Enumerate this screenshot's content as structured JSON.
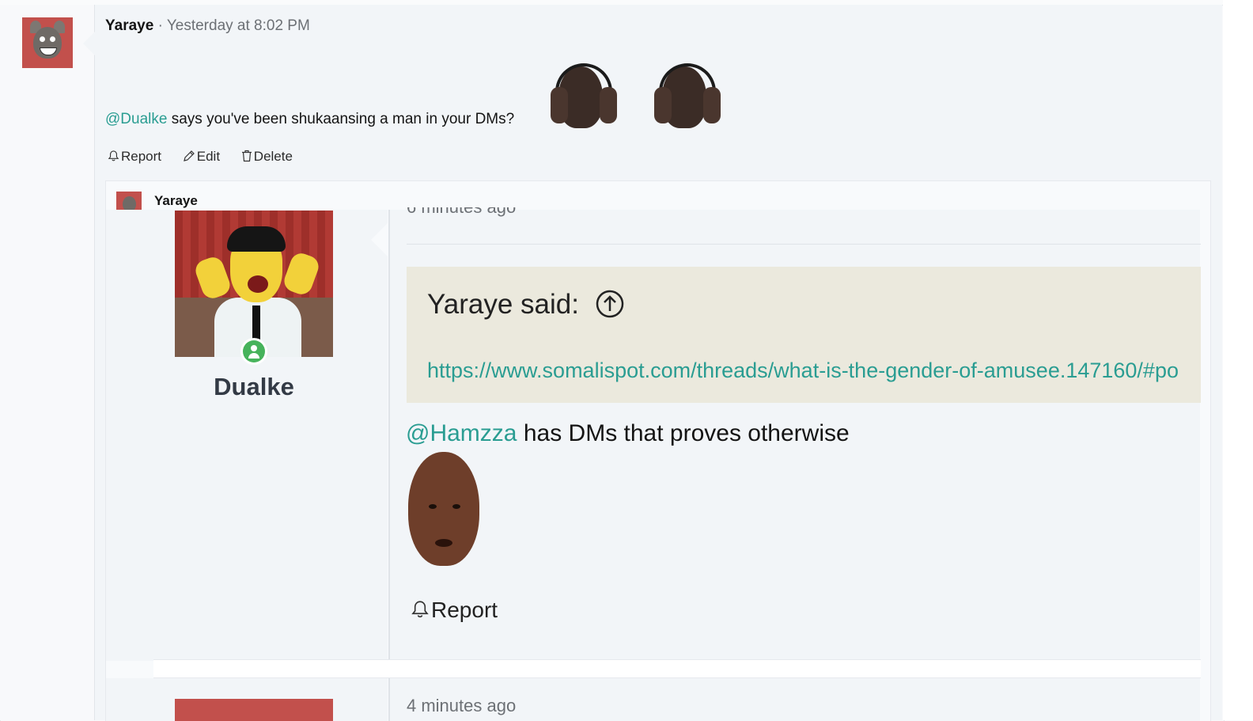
{
  "post": {
    "author": "Yaraye",
    "separator": "·",
    "timestamp": "Yesterday at 8:02 PM",
    "mention": "@Dualke",
    "message": "says you've been shukaansing a man in your DMs?",
    "actions": {
      "report": "Report",
      "edit": "Edit",
      "delete": "Delete"
    }
  },
  "embed": {
    "author": "Yaraye",
    "profile_name": "Dualke",
    "timestamp_top": "6 minutes ago",
    "quote": {
      "title": "Yaraye said:",
      "link": "https://www.somalispot.com/threads/what-is-the-gender-of-amusee.147160/#po"
    },
    "reply_mention": "@Hamzza",
    "reply_text": "has DMs that proves otherwise",
    "report_label": "Report",
    "timestamp_bottom": "4 minutes ago"
  },
  "colors": {
    "mention": "#2a9d92",
    "online": "#46b35b",
    "quote_bg": "#ebe9dd",
    "avatar_bg": "#c2504c"
  },
  "icons": [
    "bell-icon",
    "pencil-icon",
    "trash-icon",
    "arrow-up-circle-icon",
    "online-user-icon"
  ]
}
